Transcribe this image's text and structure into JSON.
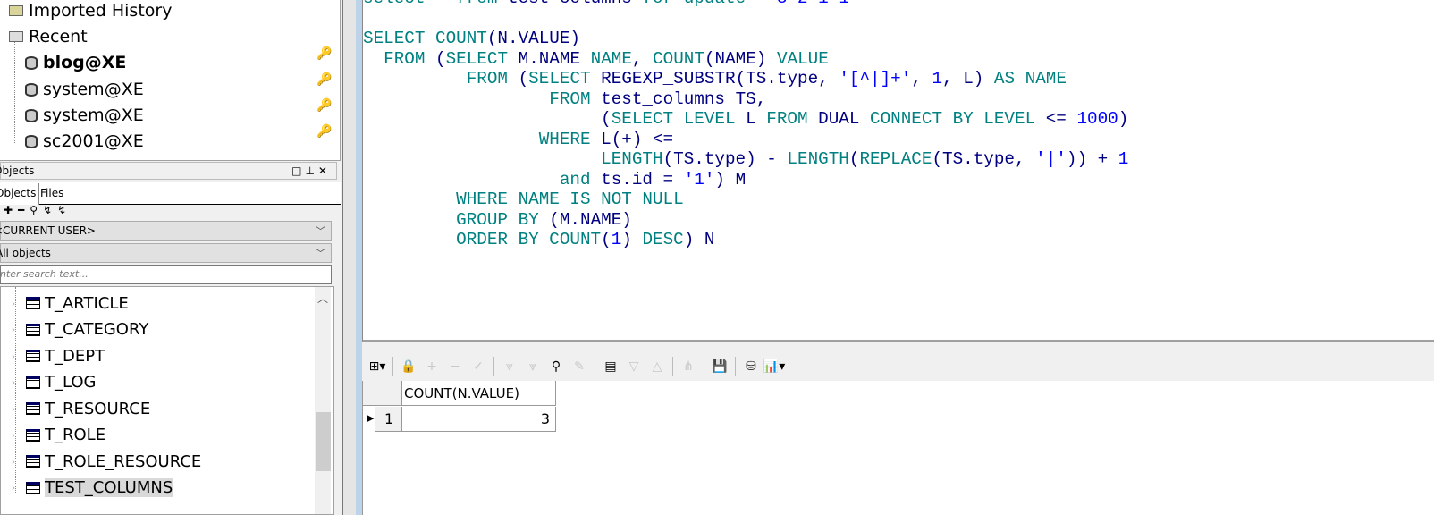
{
  "connections": {
    "folders": [
      {
        "label": "Imported History"
      },
      {
        "label": "Recent"
      }
    ],
    "items": [
      {
        "label": "blog@XE",
        "active": true
      },
      {
        "label": "system@XE"
      },
      {
        "label": "system@XE"
      },
      {
        "label": "sc2001@XE"
      }
    ]
  },
  "objects_panel": {
    "title": "Objects",
    "tabs": [
      "Objects",
      "Files"
    ],
    "owner": "<CURRENT USER>",
    "filter": "All objects",
    "search_placeholder": "Enter search text...",
    "items": [
      "T_ARTICLE",
      "T_CATEGORY",
      "T_DEPT",
      "T_LOG",
      "T_RESOURCE",
      "T_ROLE",
      "T_ROLE_RESOURCE",
      "TEST_COLUMNS"
    ],
    "selected": "TEST_COLUMNS"
  },
  "editor": {
    "colors": {
      "keyword": "#008080",
      "identifier": "#000080",
      "literal": "#0000ff"
    }
  },
  "result": {
    "columns": [
      "COUNT(N.VALUE)"
    ],
    "rows": [
      {
        "num": "1",
        "values": [
          "3"
        ]
      }
    ]
  }
}
